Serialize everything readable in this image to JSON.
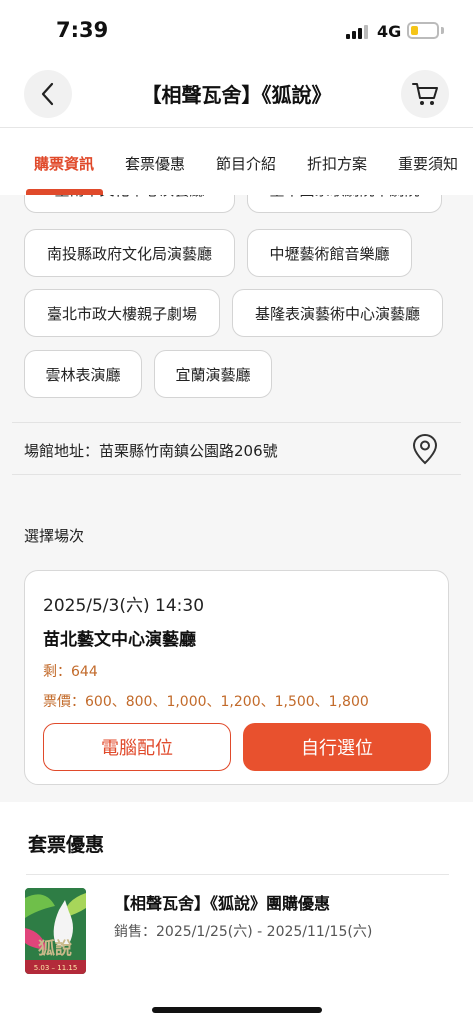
{
  "status_bar": {
    "time": "7:39",
    "network": "4G",
    "battery_level": 0.3
  },
  "nav": {
    "title": "【相聲瓦舍】《狐說》",
    "back_icon": "chevron-left-icon",
    "cart_icon": "cart-icon"
  },
  "tabs": [
    {
      "label": "購票資訊",
      "active": true
    },
    {
      "label": "套票優惠",
      "active": false
    },
    {
      "label": "節目介紹",
      "active": false
    },
    {
      "label": "折扣方案",
      "active": false
    },
    {
      "label": "重要須知",
      "active": false
    }
  ],
  "venues": [
    "臺南市文化中心演藝廳",
    "臺中國家歌劇院中劇院",
    "南投縣政府文化局演藝廳",
    "中壢藝術館音樂廳",
    "臺北市政大樓親子劇場",
    "基隆表演藝術中心演藝廳",
    "雲林表演廳",
    "宜蘭演藝廳"
  ],
  "venue_address": "場館地址：苗栗縣竹南鎮公園路206號",
  "session_section_label": "選擇場次",
  "session": {
    "datetime": "2025/5/3(六) 14:30",
    "venue": "苗北藝文中心演藝廳",
    "remaining": "剩：644",
    "prices": "票價：600、800、1,000、1,200、1,500、1,800",
    "btn_computer": "電腦配位",
    "btn_self": "自行選位"
  },
  "promo": {
    "section_title": "套票優惠",
    "item_title": "【相聲瓦舍】《狐說》團購優惠",
    "sale_period": "銷售：2025/1/25(六) - 2025/11/15(六)",
    "thumb_text": "狐說",
    "thumb_dates": "5.03 – 11.15"
  },
  "colors": {
    "accent": "#e04a2b",
    "price": "#c26a2a"
  }
}
